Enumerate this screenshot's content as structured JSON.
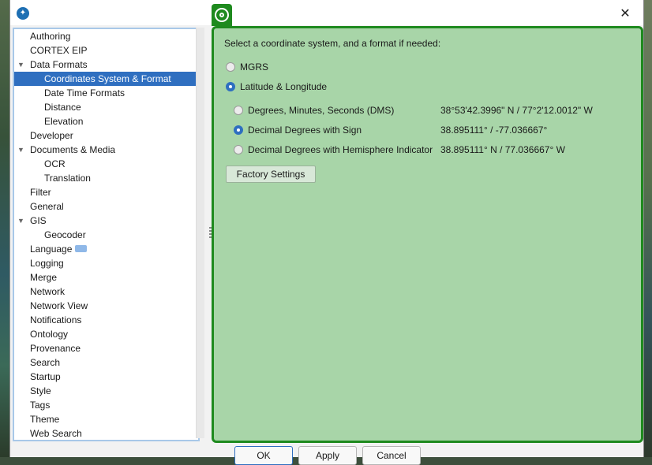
{
  "window": {
    "close_glyph": "✕"
  },
  "tree": {
    "items": [
      {
        "label": "Authoring",
        "level": 1,
        "expander": ""
      },
      {
        "label": "CORTEX EIP",
        "level": 1,
        "expander": ""
      },
      {
        "label": "Data Formats",
        "level": 1,
        "expander": "▼"
      },
      {
        "label": "Coordinates System & Format",
        "level": 2,
        "expander": "",
        "selected": true
      },
      {
        "label": "Date Time Formats",
        "level": 2,
        "expander": ""
      },
      {
        "label": "Distance",
        "level": 2,
        "expander": ""
      },
      {
        "label": "Elevation",
        "level": 2,
        "expander": ""
      },
      {
        "label": "Developer",
        "level": 1,
        "expander": ""
      },
      {
        "label": "Documents & Media",
        "level": 1,
        "expander": "▼"
      },
      {
        "label": "OCR",
        "level": 2,
        "expander": ""
      },
      {
        "label": "Translation",
        "level": 2,
        "expander": ""
      },
      {
        "label": "Filter",
        "level": 1,
        "expander": ""
      },
      {
        "label": "General",
        "level": 1,
        "expander": ""
      },
      {
        "label": "GIS",
        "level": 1,
        "expander": "▼"
      },
      {
        "label": "Geocoder",
        "level": 2,
        "expander": ""
      },
      {
        "label": "Language",
        "level": 1,
        "expander": "",
        "badge": true
      },
      {
        "label": "Logging",
        "level": 1,
        "expander": ""
      },
      {
        "label": "Merge",
        "level": 1,
        "expander": ""
      },
      {
        "label": "Network",
        "level": 1,
        "expander": ""
      },
      {
        "label": "Network View",
        "level": 1,
        "expander": ""
      },
      {
        "label": "Notifications",
        "level": 1,
        "expander": ""
      },
      {
        "label": "Ontology",
        "level": 1,
        "expander": ""
      },
      {
        "label": "Provenance",
        "level": 1,
        "expander": ""
      },
      {
        "label": "Search",
        "level": 1,
        "expander": ""
      },
      {
        "label": "Startup",
        "level": 1,
        "expander": ""
      },
      {
        "label": "Style",
        "level": 1,
        "expander": ""
      },
      {
        "label": "Tags",
        "level": 1,
        "expander": ""
      },
      {
        "label": "Theme",
        "level": 1,
        "expander": ""
      },
      {
        "label": "Web Search",
        "level": 1,
        "expander": ""
      }
    ]
  },
  "panel": {
    "prompt": "Select a coordinate system, and a format if needed:",
    "systems": [
      {
        "label": "MGRS",
        "selected": false
      },
      {
        "label": "Latitude & Longitude",
        "selected": true
      }
    ],
    "formats": [
      {
        "label": "Degrees, Minutes, Seconds (DMS)",
        "example": "38°53'42.3996\" N / 77°2'12.0012\" W",
        "selected": false
      },
      {
        "label": "Decimal Degrees with Sign",
        "example": "38.895111° / -77.036667°",
        "selected": true
      },
      {
        "label": "Decimal Degrees with Hemisphere Indicator",
        "example": "38.895111° N / 77.036667° W",
        "selected": false
      }
    ],
    "factory_button": "Factory Settings"
  },
  "footer": {
    "ok": "OK",
    "apply": "Apply",
    "cancel": "Cancel"
  },
  "colors": {
    "panel_bg": "#a8d5a8",
    "panel_border": "#1e8a1e",
    "selection": "#2f6fc0"
  }
}
